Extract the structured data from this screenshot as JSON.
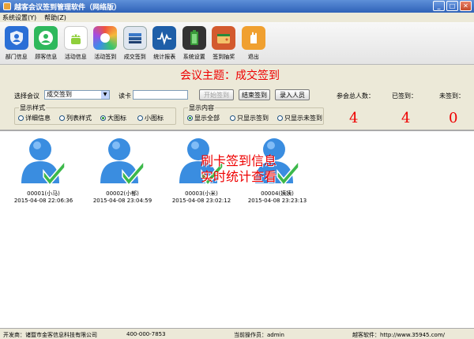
{
  "window": {
    "title": "越客会议签到管理软件（网络版）"
  },
  "menu": [
    "系统设置(Y)",
    "帮助(Z)"
  ],
  "toolbar": [
    {
      "label": "部门信息",
      "icon": "shield-user-icon",
      "color": "#2b6fd6"
    },
    {
      "label": "顾客信息",
      "icon": "person-badge-icon",
      "color": "#2eb85c"
    },
    {
      "label": "活动信息",
      "icon": "android-icon",
      "color": "#8fcf3b"
    },
    {
      "label": "活动签到",
      "icon": "colorful-ring-icon",
      "color": "#f0543c"
    },
    {
      "label": "成交签到",
      "icon": "stack-icon",
      "color": "#3b79c8"
    },
    {
      "label": "统计报表",
      "icon": "pulse-chart-icon",
      "color": "#1e5ea8"
    },
    {
      "label": "系统设置",
      "icon": "battery-icon",
      "color": "#3a9a3a"
    },
    {
      "label": "签到抽奖",
      "icon": "wallet-icon",
      "color": "#d35a2e"
    },
    {
      "label": "退出",
      "icon": "exit-hand-icon",
      "color": "#f0a030"
    }
  ],
  "panel": {
    "topic": "会议主题：成交签到",
    "select_label": "选择会议",
    "select_value": "成交签到",
    "card_label": "读卡",
    "btn_start": "开始签到",
    "btn_end": "结束签到",
    "btn_enter": "录入人员",
    "display_style": {
      "title": "显示样式",
      "options": [
        "详细信息",
        "列表样式",
        "大图标",
        "小图标"
      ],
      "selected": 2
    },
    "display_content": {
      "title": "显示内容",
      "options": [
        "显示全部",
        "只显示签到",
        "只显示未签到"
      ],
      "selected": 0
    },
    "stats": [
      {
        "label": "参会总人数：",
        "value": "4"
      },
      {
        "label": "已签到：",
        "value": "4"
      },
      {
        "label": "未签到：",
        "value": "0"
      }
    ]
  },
  "people": [
    {
      "name": "00001(小马)",
      "time": "2015-04-08 22:06:36"
    },
    {
      "name": "00002(小郁)",
      "time": "2015-04-08 23:04:59"
    },
    {
      "name": "00003(小米)",
      "time": "2015-04-08 23:02:12"
    },
    {
      "name": "00004(姨姨)",
      "time": "2015-04-08 23:23:13"
    }
  ],
  "overlay": {
    "line1": "刷卡签到信息",
    "line2": "实时统计查看"
  },
  "status": {
    "developer": "开发商：诸暨市金客信息科技有限公司",
    "phone": "400-000-7853",
    "operator": "当前操作员：admin",
    "site": "越客软件：http://www.35945.com/"
  }
}
